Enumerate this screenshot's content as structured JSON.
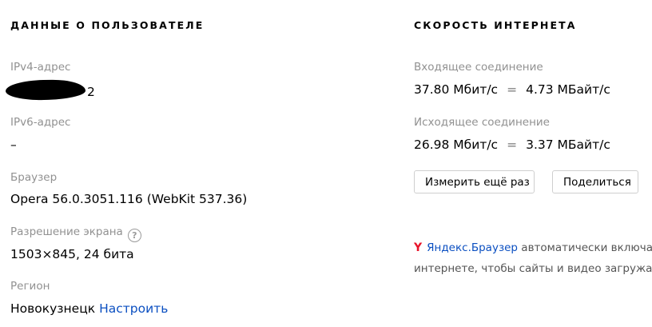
{
  "user_info": {
    "title": "ДАННЫЕ О ПОЛЬЗОВАТЕЛЕ",
    "ipv4_label": "IPv4-адрес",
    "ipv4_value_visible_tail": "2",
    "ipv6_label": "IPv6-адрес",
    "ipv6_value": "–",
    "browser_label": "Браузер",
    "browser_value": "Opera 56.0.3051.116 (WebKit 537.36)",
    "resolution_label": "Разрешение экрана",
    "resolution_value": "1503×845, 24 бита",
    "region_label": "Регион",
    "region_value": "Новокузнецк",
    "region_link": "Настроить"
  },
  "speed": {
    "title": "СКОРОСТЬ ИНТЕРНЕТА",
    "incoming_label": "Входящее соединение",
    "incoming_mbit": "37.80 Мбит/с",
    "incoming_mbyte": "4.73 МБайт/с",
    "outgoing_label": "Исходящее соединение",
    "outgoing_mbit": "26.98 Мбит/с",
    "outgoing_mbyte": "3.37 МБайт/с",
    "equals_sign": "=",
    "remeasure_button": "Измерить ещё раз",
    "share_button": "Поделиться"
  },
  "promo": {
    "logo_glyph": "Y",
    "browser_link": "Яндекс.Браузер",
    "line1_text": " автоматически включает",
    "line2_text": "интернете, чтобы сайты и видео загружались"
  },
  "colors": {
    "link": "#0b4fc1",
    "label_gray": "#919191",
    "yandex_red": "#e8142a"
  },
  "icons": {
    "help": "question-circle-icon"
  }
}
